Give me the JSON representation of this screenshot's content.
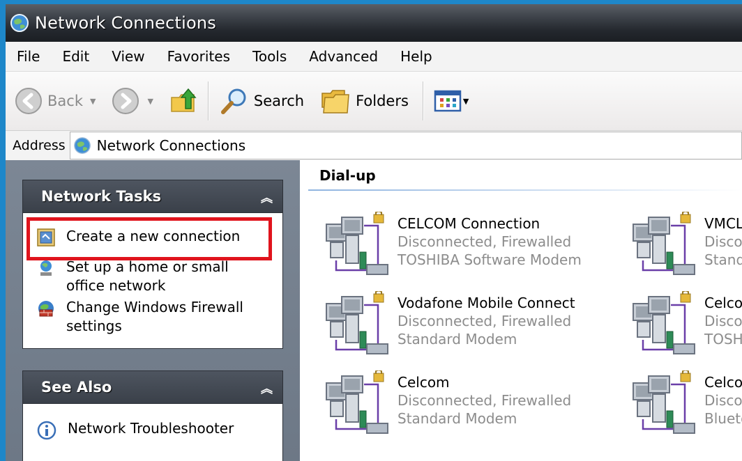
{
  "window": {
    "title": "Network Connections"
  },
  "menu": [
    "File",
    "Edit",
    "View",
    "Favorites",
    "Tools",
    "Advanced",
    "Help"
  ],
  "toolbar": {
    "back_label": "Back",
    "search_label": "Search",
    "folders_label": "Folders"
  },
  "address": {
    "label": "Address",
    "value": "Network Connections"
  },
  "network_tasks": {
    "title": "Network Tasks",
    "items": [
      {
        "label": "Create a new connection"
      },
      {
        "label": "Set up a home or small office network"
      },
      {
        "label": "Change Windows Firewall settings"
      }
    ]
  },
  "see_also": {
    "title": "See Also",
    "items": [
      {
        "label": "Network Troubleshooter"
      }
    ]
  },
  "group": {
    "title": "Dial-up"
  },
  "connections": [
    {
      "name": "CELCOM Connection",
      "status": "Disconnected, Firewalled",
      "device": "TOSHIBA Software Modem"
    },
    {
      "name": "VMCLi",
      "status": "Discor",
      "device": "Stand"
    },
    {
      "name": "Vodafone Mobile Connect",
      "status": "Disconnected, Firewalled",
      "device": "Standard Modem"
    },
    {
      "name": "Celcol",
      "status": "Discor",
      "device": "TOSH"
    },
    {
      "name": "Celcom",
      "status": "Disconnected, Firewalled",
      "device": "Standard Modem"
    },
    {
      "name": "Celcol",
      "status": "Discor",
      "device": "Blueto"
    }
  ],
  "colors": {
    "highlight": "#e0141d",
    "title_bar": "#2b2f35",
    "task_pane": "#747f8d",
    "desktop": "#1e87c9"
  }
}
